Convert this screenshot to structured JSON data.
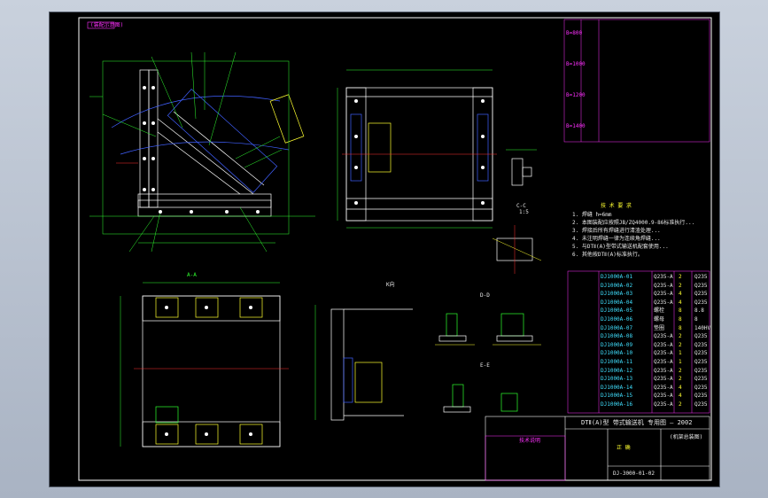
{
  "window": {
    "title": ""
  },
  "title_block": {
    "product": "DTⅡ(A)型  带式输送机  专用图 — 2002",
    "doc_label": "正 确",
    "drawing_no": "DJ-3000-01-02",
    "subtitle": "(机架总装图)"
  },
  "notes": {
    "heading": "技  术  要  求",
    "lines": [
      "1. 焊缝 h=6mm",
      "2. 本图装配应按照JB/ZQ4000.9-86标准执行...",
      "3. 焊接后所有焊缝进行清渣处理...",
      "4. 未注明焊缝一律为连续角焊缝...",
      "5. 与DTⅡ(A)型带式输送机配套使用...",
      "6. 其他按DTⅡ(A)标准执行。"
    ]
  },
  "view_labels": {
    "top_left_tag": "(装配示意图)",
    "section_aa": "A-A",
    "view_k": "K向",
    "section_d": "D-D",
    "section_e": "E-E",
    "section_c": "C-C",
    "scale_1_5": "1:5",
    "bottom_note_title": "技术说明"
  },
  "parts_table": {
    "rows": [
      {
        "code": "DJ1000A-01",
        "name": "Q235-A",
        "qty": "2",
        "mat": "Q235"
      },
      {
        "code": "DJ1000A-02",
        "name": "Q235-A",
        "qty": "2",
        "mat": "Q235"
      },
      {
        "code": "DJ1000A-03",
        "name": "Q235-A",
        "qty": "4",
        "mat": "Q235"
      },
      {
        "code": "DJ1000A-04",
        "name": "Q235-A",
        "qty": "4",
        "mat": "Q235"
      },
      {
        "code": "DJ1000A-05",
        "name": "螺栓",
        "qty": "8",
        "mat": "8.8"
      },
      {
        "code": "DJ1000A-06",
        "name": "螺母",
        "qty": "8",
        "mat": "8"
      },
      {
        "code": "DJ1000A-07",
        "name": "垫圈",
        "qty": "8",
        "mat": "140HV"
      },
      {
        "code": "DJ1000A-08",
        "name": "Q235-A",
        "qty": "2",
        "mat": "Q235"
      },
      {
        "code": "DJ1000A-09",
        "name": "Q235-A",
        "qty": "2",
        "mat": "Q235"
      },
      {
        "code": "DJ1000A-10",
        "name": "Q235-A",
        "qty": "1",
        "mat": "Q235"
      },
      {
        "code": "DJ1000A-11",
        "name": "Q235-A",
        "qty": "1",
        "mat": "Q235"
      },
      {
        "code": "DJ1000A-12",
        "name": "Q235-A",
        "qty": "2",
        "mat": "Q235"
      },
      {
        "code": "DJ1000A-13",
        "name": "Q235-A",
        "qty": "2",
        "mat": "Q235"
      },
      {
        "code": "DJ1000A-14",
        "name": "Q235-A",
        "qty": "4",
        "mat": "Q235"
      },
      {
        "code": "DJ1000A-15",
        "name": "Q235-A",
        "qty": "4",
        "mat": "Q235"
      },
      {
        "code": "DJ1000A-16",
        "name": "Q235-A",
        "qty": "2",
        "mat": "Q235"
      }
    ]
  },
  "spec_table": {
    "groups": [
      "B=800",
      "B=1000",
      "B=1200",
      "B=1400"
    ]
  },
  "colors": {
    "frame": "#ffffff",
    "dim": "#30ff30",
    "table": "#ff30ff",
    "hidden": "#4060ff",
    "center": "#ff3030",
    "note": "#ffff30"
  }
}
